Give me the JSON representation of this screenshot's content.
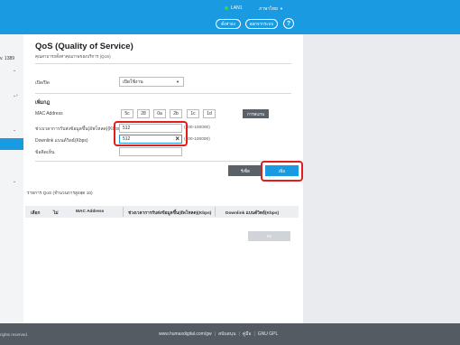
{
  "header": {
    "lan_label": "LAN1",
    "language": "ภาษาไทย",
    "cancel_button": "ตั้งค่าอง",
    "logout_button": "ออกจากระบบ",
    "help": "?"
  },
  "sidebar": {
    "firmware_fragment": "v. 1389"
  },
  "page": {
    "title": "QoS (Quality of Service)",
    "subtitle": "คุณสามารถตั้งค่าคุณภาพของบริการ (QoS)",
    "enable_label": "เปิด/ปิด",
    "enable_value": "เปิดใช้งาน",
    "section_add": "เพิ่มกฎ",
    "mac_label": "MAC Address",
    "mac_values": [
      "5c",
      "28",
      "0a",
      "2b",
      "1c",
      "1d"
    ],
    "mac_search_button": "การสแกน",
    "uplink_label": "ช่วงเวลาการรับส่งข้อมูลขึ้น(อัพโหลด)(Kbps)",
    "uplink_value": "512",
    "uplink_range": "(100-100000)",
    "downlink_label": "Downlink แบนด์วิดธ์(Kbps)",
    "downlink_value": "512",
    "downlink_range": "(100-100000)",
    "comment_label": "ข้อคิดเห็น",
    "comment_value": "",
    "reset_button": "รีเซ็ต",
    "add_button": "เพิ่ม",
    "list_title": "รายการ QoS (จำนวนการสูงสุด 10)",
    "table_headers": [
      "เลือก",
      "ไม่",
      "MAC Address",
      "ช่วงเวลาการรับส่งข้อมูลขึ้น(อัพโหลด)(Kbps)",
      "Downlink แบนด์วิดธ์(Kbps)"
    ],
    "delete_button": "ลบ"
  },
  "footer": {
    "rights": "rights reserved.",
    "site": "www.humaxdigital.com/gw",
    "support": "สนับสนุน",
    "manual": "คู่มือ",
    "gpl": "GNU GPL"
  },
  "colors": {
    "accent": "#1a9ae0",
    "highlight": "#e21d1d",
    "footer": "#555b63",
    "dark_button": "#5a6169"
  }
}
